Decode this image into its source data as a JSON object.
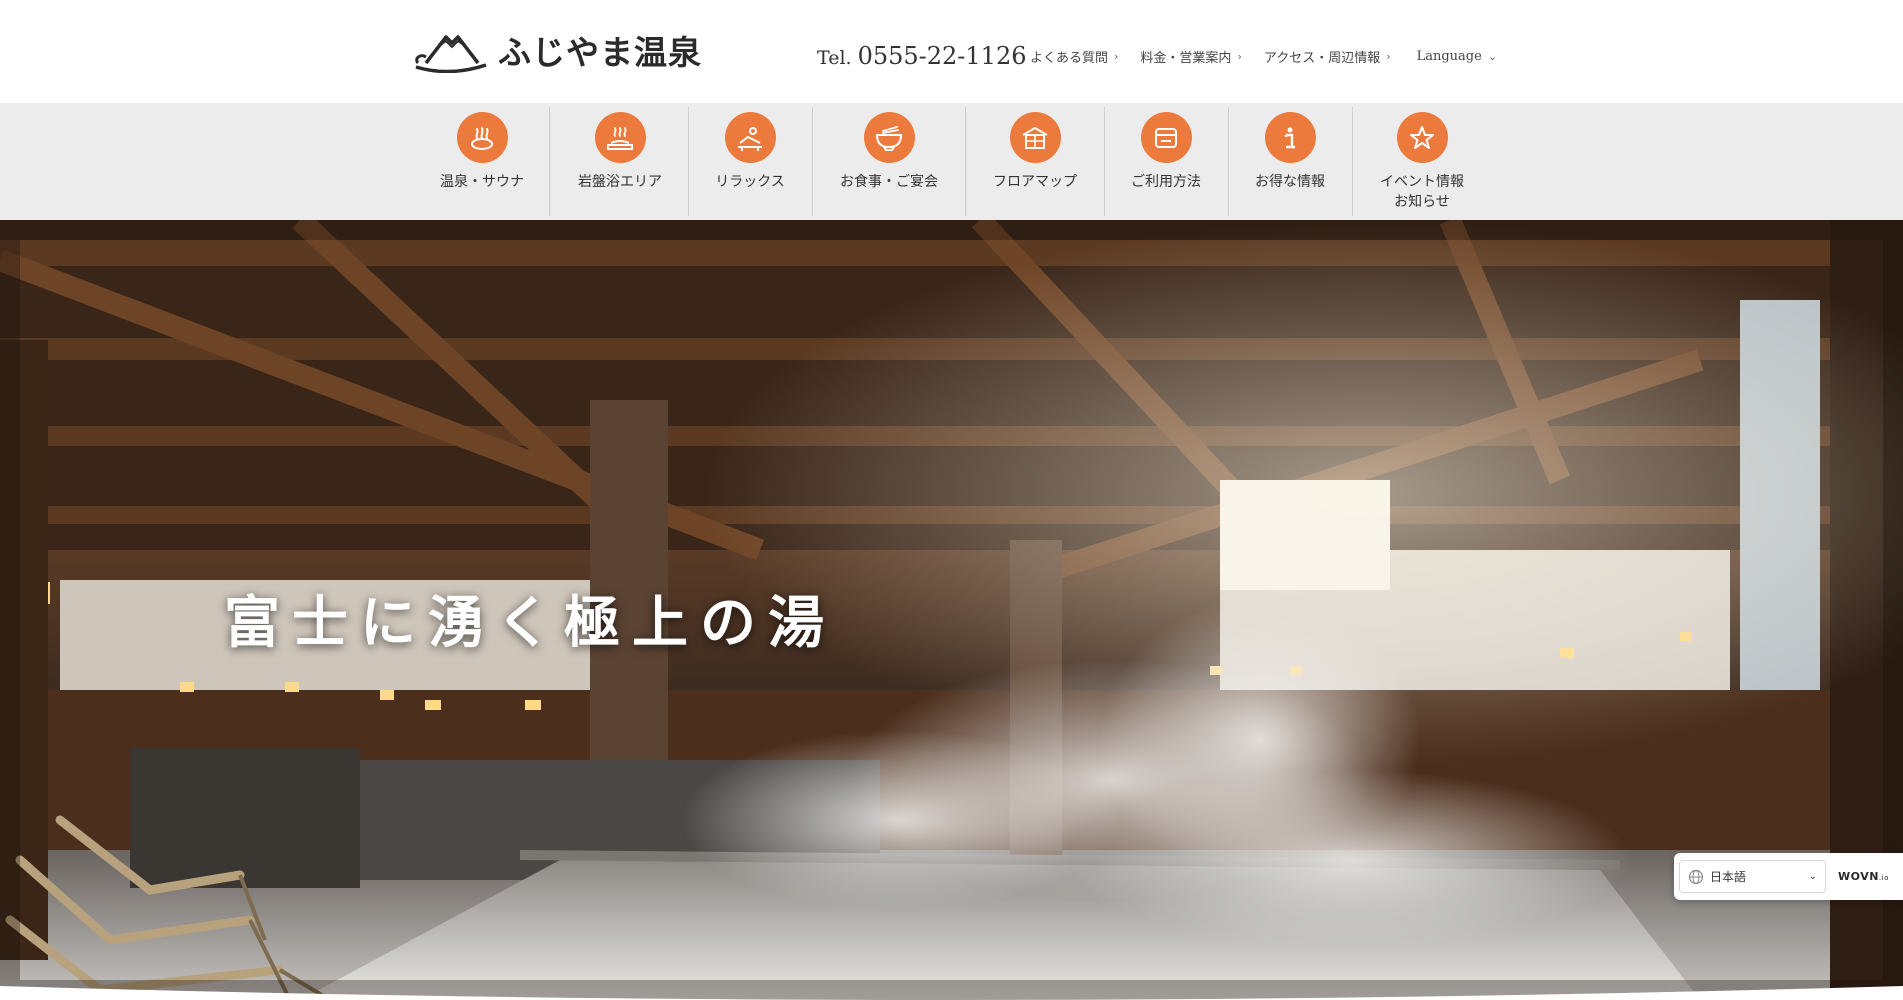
{
  "header": {
    "logo_text": "ふじやま温泉",
    "tel_label": "Tel.",
    "tel_number": "0555-22-1126",
    "nav": [
      {
        "label": "よくある質問"
      },
      {
        "label": "料金・営業案内"
      },
      {
        "label": "アクセス・周辺情報"
      },
      {
        "label": "Language"
      }
    ]
  },
  "categories": [
    {
      "label": "温泉・サウナ",
      "icon": "hot-spring-icon"
    },
    {
      "label": "岩盤浴エリア",
      "icon": "bedrock-bath-icon"
    },
    {
      "label": "リラックス",
      "icon": "relax-icon"
    },
    {
      "label": "お食事・ご宴会",
      "icon": "dining-bowl-icon"
    },
    {
      "label": "フロアマップ",
      "icon": "floor-map-icon"
    },
    {
      "label": "ご利用方法",
      "icon": "usage-guide-icon"
    },
    {
      "label": "お得な情報",
      "icon": "info-icon"
    },
    {
      "label": "イベント情報",
      "label2": "お知らせ",
      "icon": "star-icon"
    }
  ],
  "hero": {
    "title": "富士に湧く極上の湯"
  },
  "language_widget": {
    "selected": "日本語",
    "brand": "WOVN",
    "brand_suffix": ".io"
  },
  "colors": {
    "accent": "#ec7a3c",
    "nav_background": "#ececec"
  }
}
